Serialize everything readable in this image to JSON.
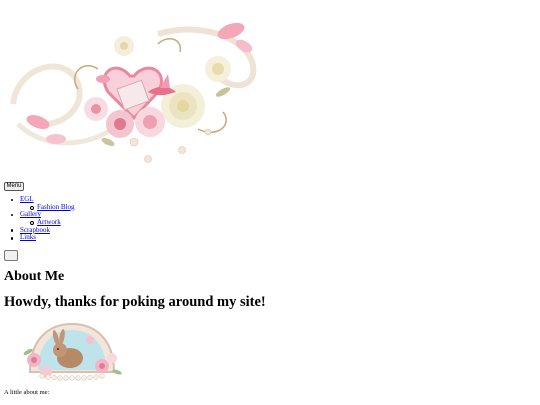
{
  "header": {
    "banner_icon": "floral-heart-cluster-icon",
    "colors": {
      "pink": "#f4a7b9",
      "rose": "#e86f8e",
      "cream": "#f6f1e0",
      "gold": "#c9a97a"
    }
  },
  "menu_button": {
    "label": "Menu"
  },
  "nav": {
    "items": [
      {
        "label": "EGL",
        "children": [
          {
            "label": "Fashion Blog"
          }
        ]
      },
      {
        "label": "Gallery",
        "children": [
          {
            "label": "Artwork"
          }
        ]
      },
      {
        "label": "Scrapbook"
      },
      {
        "label": "Links"
      }
    ]
  },
  "extra_button": {
    "label": ""
  },
  "main": {
    "title": "About Me",
    "heading": "Howdy, thanks for poking around my site!",
    "avatar_icon": "bunny-pearl-frame-icon",
    "intro": "A little about me:"
  }
}
